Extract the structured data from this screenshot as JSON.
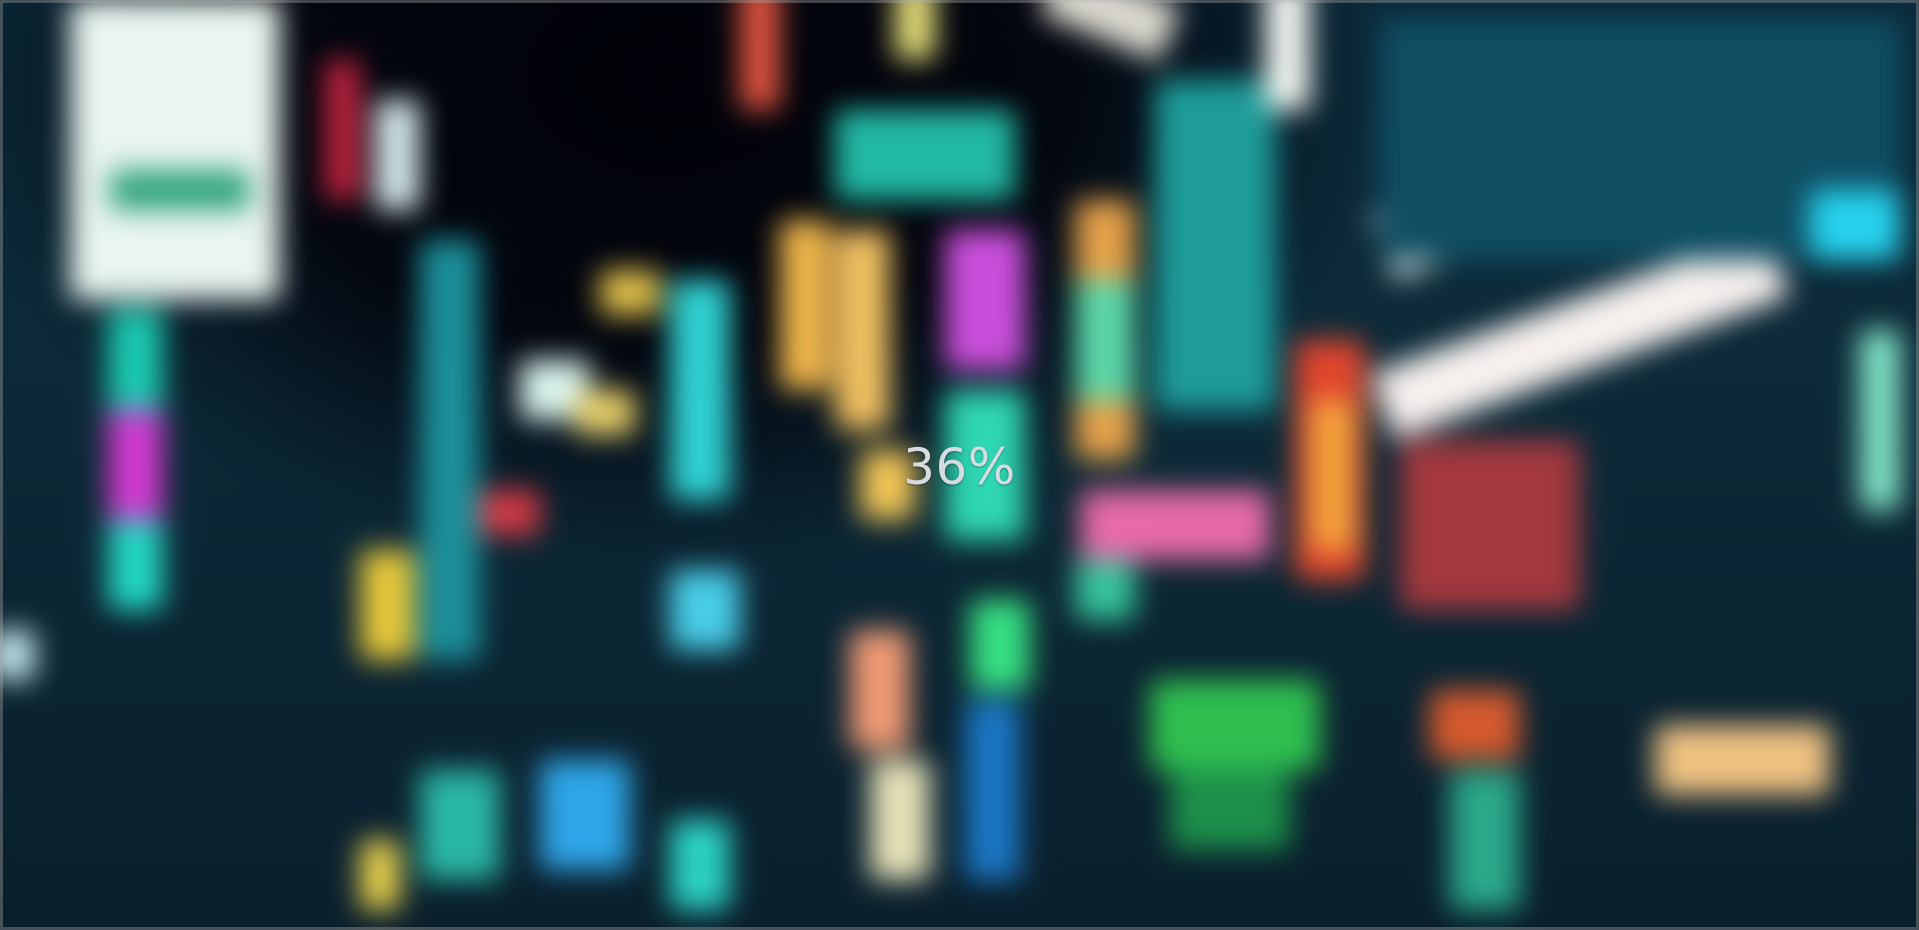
{
  "loading": {
    "progress_label": "36%",
    "progress_value": 36
  },
  "background": {
    "description_colors": {
      "teal": "#1bc9c0",
      "magenta": "#d13ad1",
      "amber": "#f0b64a",
      "red": "#e2452d",
      "white": "#eef6f2",
      "deep_blue": "#0a1f2c"
    }
  }
}
